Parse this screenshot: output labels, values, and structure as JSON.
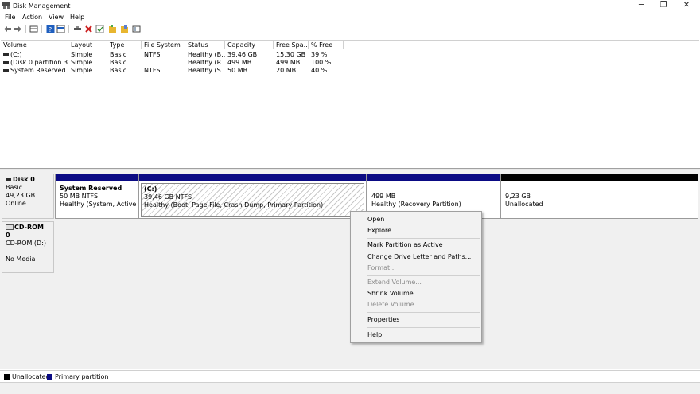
{
  "window": {
    "title": "Disk Management",
    "minimize_glyph": "─",
    "restore_glyph": "❐",
    "close_glyph": "✕"
  },
  "menu": [
    "File",
    "Action",
    "View",
    "Help"
  ],
  "toolbar": {
    "icons": [
      "back-arrow-icon",
      "forward-arrow-icon",
      "disk-list-icon",
      "help-icon",
      "properties-icon",
      "connect-icon",
      "delete-icon",
      "check-icon",
      "folder-icon",
      "folder-open-icon",
      "settings-panel-icon"
    ],
    "colors": {
      "arrow": "#6b6b6b",
      "help": "#1f5fbf",
      "delete": "#cc1f1f",
      "folder": "#e8b630"
    }
  },
  "volume_list": {
    "columns": [
      "Volume",
      "Layout",
      "Type",
      "File System",
      "Status",
      "Capacity",
      "Free Spa...",
      "% Free"
    ],
    "rows": [
      [
        "(C:)",
        "Simple",
        "Basic",
        "NTFS",
        "Healthy (B...",
        "39,46 GB",
        "15,30 GB",
        "39 %"
      ],
      [
        "(Disk 0 partition 3)",
        "Simple",
        "Basic",
        "",
        "Healthy (R...",
        "499 MB",
        "499 MB",
        "100 %"
      ],
      [
        "System Reserved",
        "Simple",
        "Basic",
        "NTFS",
        "Healthy (S...",
        "50 MB",
        "20 MB",
        "40 %"
      ]
    ]
  },
  "disk0": {
    "name": "Disk 0",
    "type": "Basic",
    "size": "49,23 GB",
    "state": "Online",
    "partitions": [
      {
        "title": "System Reserved",
        "size": "50 MB NTFS",
        "status": "Healthy (System, Active, Prir"
      },
      {
        "title": "(C:)",
        "size": "39,46 GB NTFS",
        "status": "Healthy (Boot, Page File, Crash Dump, Primary Partition)"
      },
      {
        "title": "",
        "size": "499 MB",
        "status": "Healthy (Recovery Partition)"
      },
      {
        "title": "",
        "size": "9,23 GB",
        "status": "Unallocated"
      }
    ]
  },
  "cdrom": {
    "name": "CD-ROM 0",
    "drive": "CD-ROM (D:)",
    "media": "No Media"
  },
  "legend": [
    {
      "label": "Unallocated",
      "color": "#000000"
    },
    {
      "label": "Primary partition",
      "color": "#0a0a84"
    }
  ],
  "context_menu": {
    "items": [
      {
        "label": "Open",
        "enabled": true
      },
      {
        "label": "Explore",
        "enabled": true
      },
      {
        "label": "Mark Partition as Active",
        "enabled": true
      },
      {
        "label": "Change Drive Letter and Paths...",
        "enabled": true
      },
      {
        "label": "Format...",
        "enabled": false
      },
      {
        "label": "Extend Volume...",
        "enabled": false
      },
      {
        "label": "Shrink Volume...",
        "enabled": true
      },
      {
        "label": "Delete Volume...",
        "enabled": false
      },
      {
        "label": "Properties",
        "enabled": true
      },
      {
        "label": "Help",
        "enabled": true
      }
    ]
  }
}
